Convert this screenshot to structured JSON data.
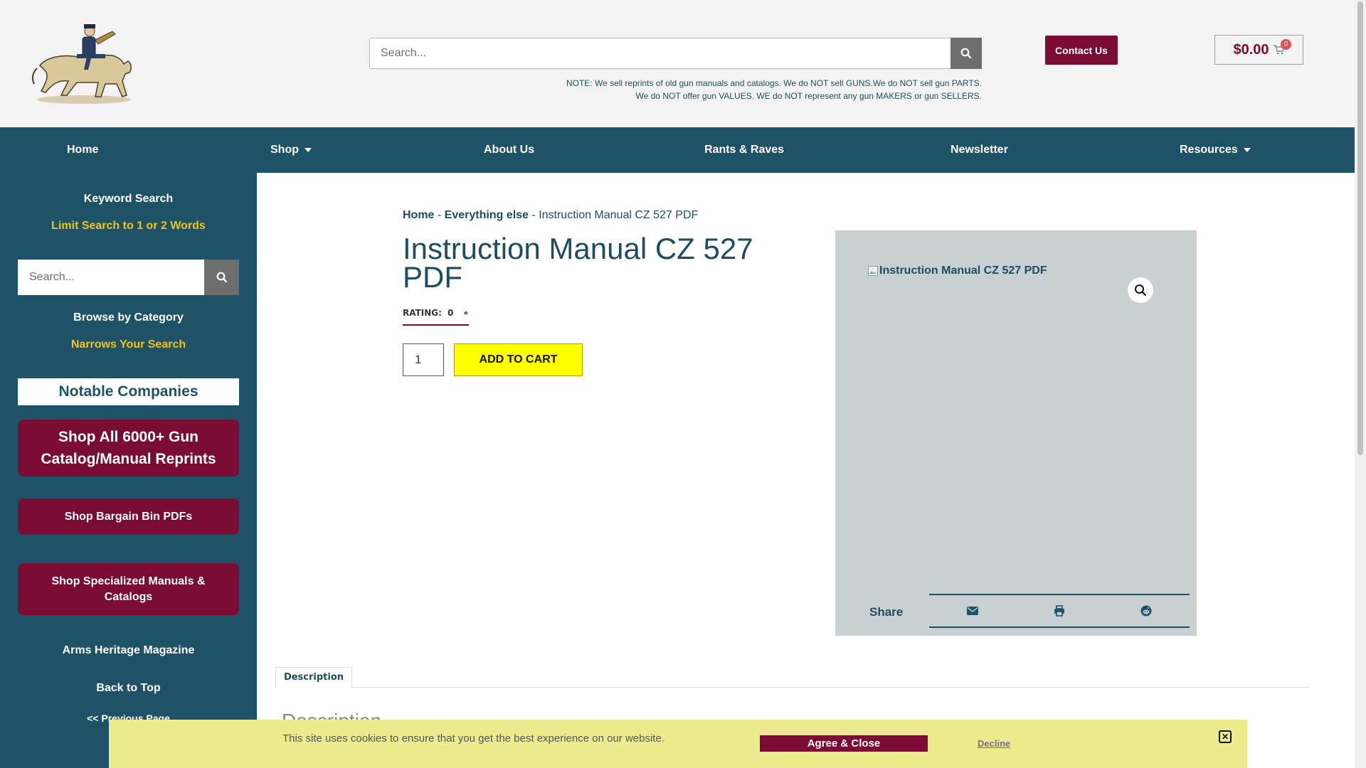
{
  "header": {
    "search_placeholder": "Search...",
    "notice_line1": "NOTE: We sell reprints of old gun manuals and catalogs. We do NOT sell GUNS.We do NOT sell gun PARTS.",
    "notice_line2": "We do NOT offer gun VALUES. WE do NOT represent any gun MAKERS or gun SELLERS.",
    "contact_label": "Contact Us",
    "cart_total": "$0.00",
    "cart_count": "0"
  },
  "nav": {
    "home": "Home",
    "shop": "Shop",
    "about": "About Us",
    "rants": "Rants & Raves",
    "newsletter": "Newsletter",
    "resources": "Resources"
  },
  "sidebar": {
    "keyword_search": "Keyword Search",
    "limit_search": "Limit Search to 1 or 2 Words",
    "search_placeholder": "Search...",
    "browse_category": "Browse by Category",
    "narrows": "Narrows Your Search",
    "notable": "Notable Companies",
    "shop_all": "Shop All 6000+ Gun Catalog/Manual Reprints",
    "bargain": "Shop Bargain Bin PDFs",
    "specialized": "Shop Specialized Manuals & Catalogs",
    "magazine": "Arms Heritage Magazine",
    "back_to_top": "Back to Top",
    "previous_page": "<< Previous Page"
  },
  "breadcrumb": {
    "home": "Home",
    "sep1": " - ",
    "category": "Everything else",
    "sep2": " - ",
    "current": "Instruction Manual CZ 527 PDF"
  },
  "product": {
    "title": "Instruction Manual CZ 527 PDF",
    "rating_label": "RATING:",
    "rating_value": "0",
    "quantity": "1",
    "add_to_cart": "ADD TO CART",
    "image_alt": "Instruction Manual CZ 527 PDF",
    "share_label": "Share"
  },
  "tabs": {
    "description_tab": "Description",
    "description_heading": "Description"
  },
  "cookie": {
    "text": "This site uses cookies to ensure that you get the best experience on our website.",
    "agree": "Agree & Close",
    "decline": "Decline"
  },
  "colors": {
    "brand_teal": "#1e5267",
    "maroon": "#7a0b32",
    "accent_yellow": "#f0c419",
    "cart_button_yellow": "#ffff00"
  }
}
